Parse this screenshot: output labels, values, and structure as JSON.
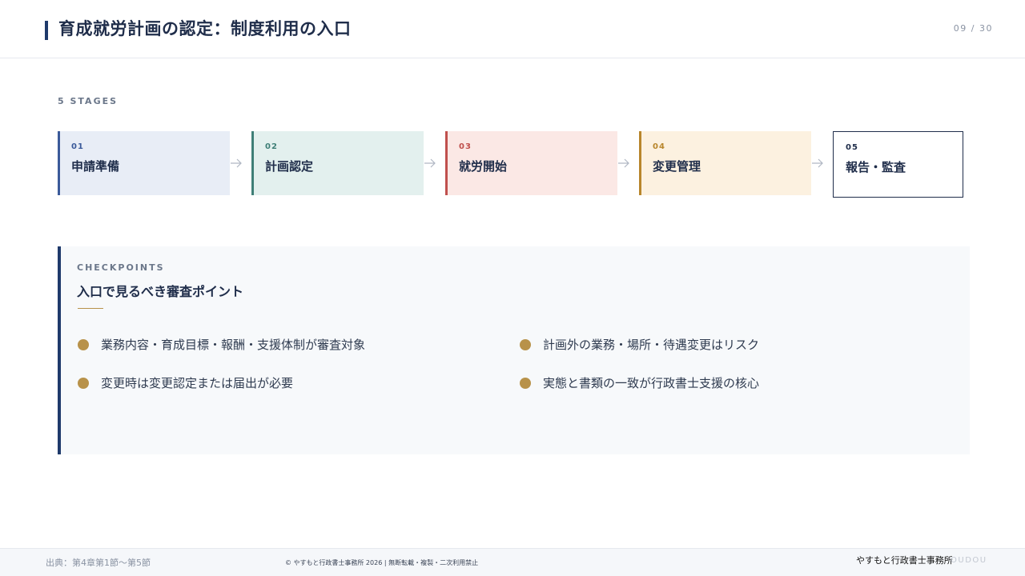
{
  "header": {
    "title": "育成就労計画の認定：制度利用の入口",
    "page_number": "09 / 30"
  },
  "stages": {
    "label": "5 STAGES",
    "items": [
      {
        "num": "01",
        "name": "申請準備",
        "accent": "#3b5a9a",
        "bg": "#e8edf6"
      },
      {
        "num": "02",
        "name": "計画認定",
        "accent": "#3f7f77",
        "bg": "#e3f0ee"
      },
      {
        "num": "03",
        "name": "就労開始",
        "accent": "#c0504d",
        "bg": "#fbe8e5"
      },
      {
        "num": "04",
        "name": "変更管理",
        "accent": "#b8862c",
        "bg": "#fcf1e0"
      },
      {
        "num": "05",
        "name": "報告・監査",
        "accent": "#1f2d4a",
        "bg": "#ffffff"
      }
    ]
  },
  "checkpoints": {
    "label": "CHECKPOINTS",
    "title": "入口で見るべき審査ポイント",
    "items": [
      "業務内容・育成目標・報酬・支援体制が審査対象",
      "計画外の業務・場所・待遇変更はリスク",
      "変更時は変更認定または届出が必要",
      "実態と書類の一致が行政書士支援の核心"
    ]
  },
  "footer": {
    "source": "出典：第4章第1節〜第5節",
    "copyright": "© やすもと行政書士事務所 2026 | 無断転載・複製・二次利用禁止",
    "brand": "やすもと行政書士事務所",
    "brand_en": "OUDOU"
  },
  "colors": {
    "navy": "#1f3a6b",
    "gold": "#b8924a"
  }
}
